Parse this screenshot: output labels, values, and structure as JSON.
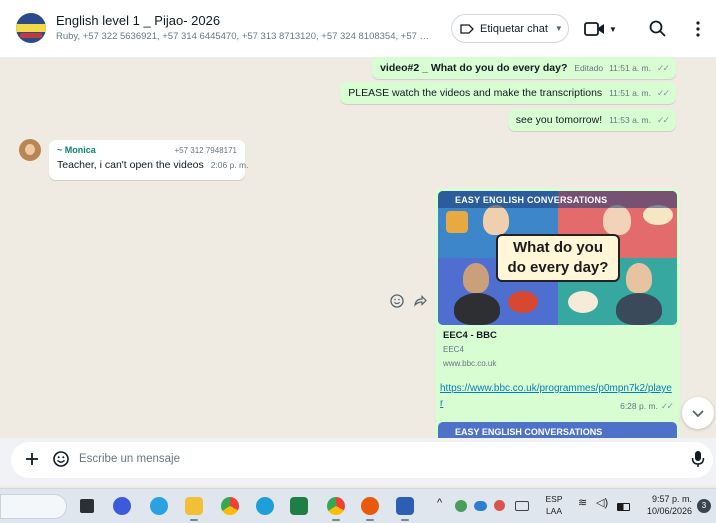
{
  "header": {
    "title": "English level 1 _ Pijao- 2026",
    "members": "Ruby, +57 322 5636921, +57 314 6445470, +57 313 8713120, +57 324 8108354, +57 317 ...",
    "tag_label": "Etiquetar chat"
  },
  "messages": [
    {
      "text": "video#2 _ What do you do every day?",
      "edited": "Editado",
      "time": "11:51 a. m.",
      "ticks": "✓✓"
    },
    {
      "text": "PLEASE watch the videos and make the transcriptions",
      "time": "11:51 a. m.",
      "ticks": "✓✓"
    },
    {
      "text": "see you tomorrow!",
      "time": "11:53 a. m.",
      "ticks": "✓✓"
    }
  ],
  "incoming": {
    "sender": "~ Monica",
    "phone": "+57 312 7948171",
    "text": "Teacher, i can't open the videos",
    "time": "2:06 p. m."
  },
  "preview": {
    "banner": "EASY ENGLISH CONVERSATIONS",
    "headline_1": "What do you",
    "headline_2": "do every day?",
    "title": "EEC4 - BBC",
    "subtitle": "EEC4",
    "domain": "www.bbc.co.uk",
    "link": "https://www.bbc.co.uk/programmes/p0mpn7k2/player",
    "time": "6:28 p. m.",
    "ticks": "✓✓"
  },
  "preview2": {
    "banner": "EASY ENGLISH CONVERSATIONS"
  },
  "composer": {
    "placeholder": "Escribe un mensaje"
  },
  "taskbar": {
    "lang_1": "ESP",
    "lang_2": "LAA",
    "time": "9:57 p. m.",
    "date": "10/06/2026",
    "notifications": "3"
  },
  "colors": {
    "outgoing_bubble": "#d9fdd3",
    "incoming_bubble": "#ffffff",
    "chat_background": "#efeae2",
    "link": "#027eb5",
    "sender_name": "#06846f"
  }
}
